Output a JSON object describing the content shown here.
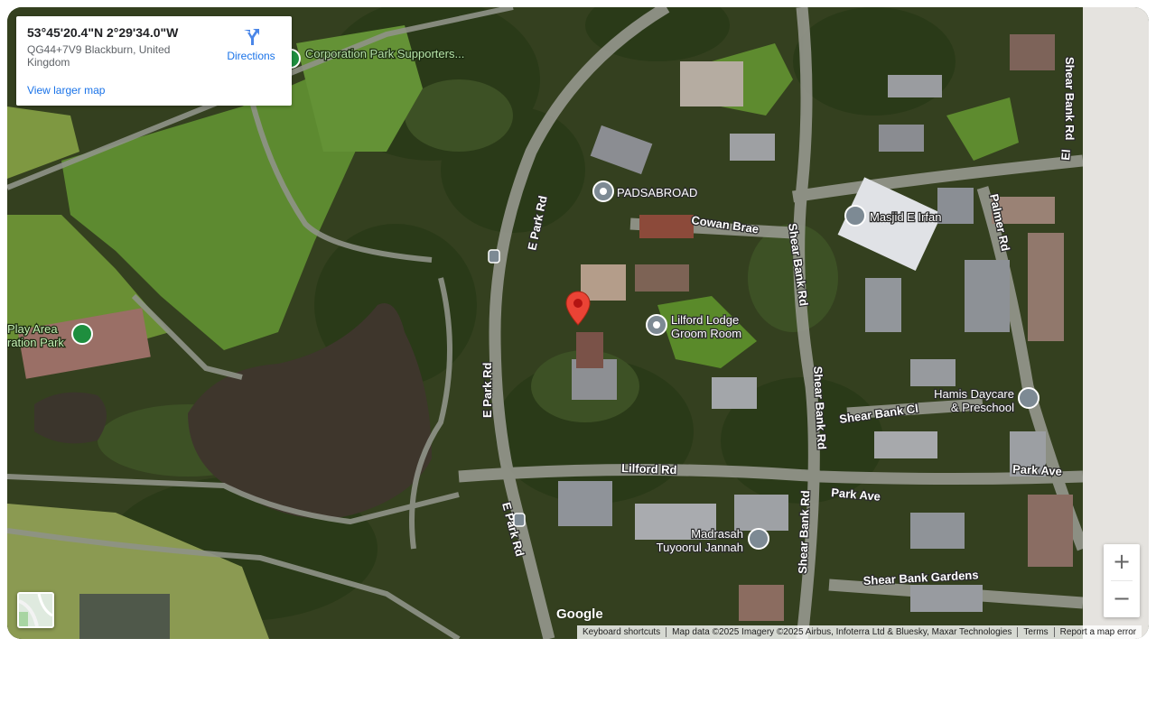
{
  "info_card": {
    "coordinates": "53°45'20.4\"N 2°29'34.0\"W",
    "address": "QG44+7V9 Blackburn, United Kingdom",
    "directions_label": "Directions",
    "larger_map_label": "View larger map"
  },
  "places": [
    {
      "id": "corporation-park",
      "label": "Corporation Park Supporters..."
    },
    {
      "id": "padsabroad",
      "label": "PADSABROAD"
    },
    {
      "id": "masjid",
      "label": "Masjid E Irfan"
    },
    {
      "id": "lilford-lodge",
      "label": "Lilford Lodge Groom Room"
    },
    {
      "id": "play-area",
      "label": "Play Area ration Park"
    },
    {
      "id": "hamis",
      "label": "Hamis Daycare & Preschool"
    },
    {
      "id": "madrasah",
      "label": "Madrasah Tuyoorul Jannah"
    }
  ],
  "streets": {
    "e_park_rd_1": "E Park Rd",
    "e_park_rd_2": "E Park Rd",
    "e_park_rd_3": "E Park Rd",
    "cowan_brae": "Cowan Brae",
    "shear_bank_rd_1": "Shear Bank Rd",
    "shear_bank_rd_2": "Shear Bank Rd",
    "shear_bank_rd_3": "Shear Bank Rd",
    "shear_bank_rd_4": "Shear Bank Rd",
    "palmer_rd": "Palmer Rd",
    "shear_bank_cl": "Shear Bank Cl",
    "lilford_rd": "Lilford Rd",
    "park_ave_1": "Park Ave",
    "park_ave_2": "Park Ave",
    "shear_bank_gardens": "Shear Bank Gardens",
    "el": "El"
  },
  "google_logo": "Google",
  "attribution": {
    "keyboard": "Keyboard shortcuts",
    "map_data": "Map data ©2025 Imagery ©2025 Airbus, Infoterra Ltd & Bluesky, Maxar Technologies",
    "terms": "Terms",
    "report": "Report a map error"
  },
  "zoom": {
    "in_label": "+",
    "out_label": "−"
  },
  "colors": {
    "marker": "#ea4335",
    "link": "#1a73e8",
    "poi_grey": "#7d8a94",
    "poi_green": "#1e8e3e"
  }
}
